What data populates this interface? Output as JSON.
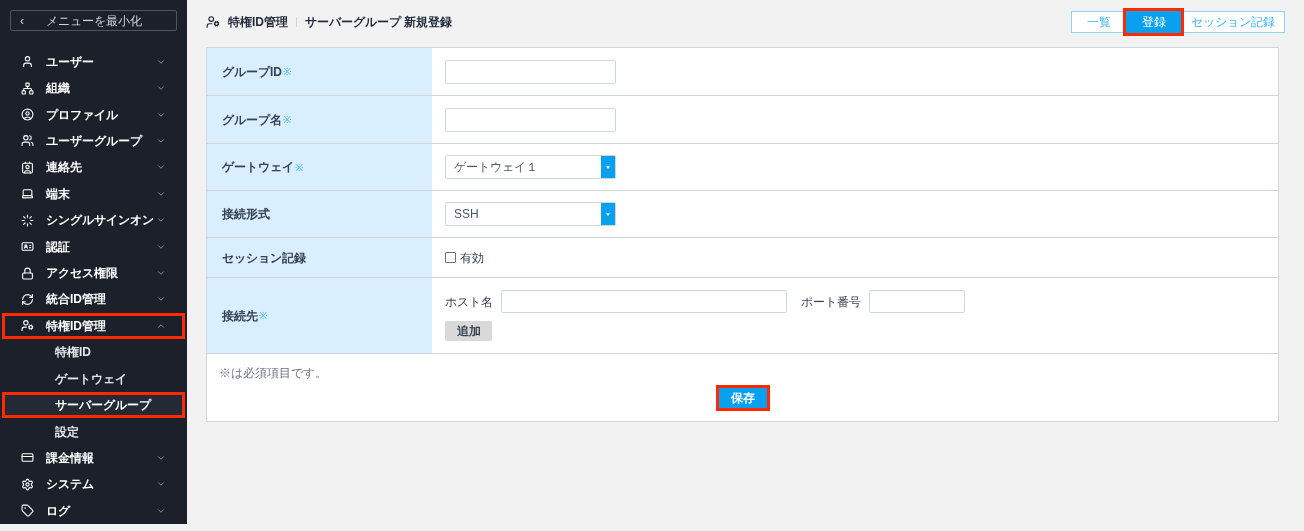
{
  "sidebar": {
    "collapse_button": {
      "icon": "‹",
      "label": "メニューを最小化"
    },
    "items": [
      {
        "label": "ユーザー",
        "expanded": false,
        "highlighted": false
      },
      {
        "label": "組織",
        "expanded": false,
        "highlighted": false
      },
      {
        "label": "プロファイル",
        "expanded": false,
        "highlighted": false
      },
      {
        "label": "ユーザーグループ",
        "expanded": false,
        "highlighted": false
      },
      {
        "label": "連絡先",
        "expanded": false,
        "highlighted": false
      },
      {
        "label": "端末",
        "expanded": false,
        "highlighted": false
      },
      {
        "label": "シングルサインオン",
        "expanded": false,
        "highlighted": false
      },
      {
        "label": "認証",
        "expanded": false,
        "highlighted": false
      },
      {
        "label": "アクセス権限",
        "expanded": false,
        "highlighted": false
      },
      {
        "label": "統合ID管理",
        "expanded": false,
        "highlighted": false
      },
      {
        "label": "特権ID管理",
        "expanded": true,
        "highlighted": true,
        "children": [
          {
            "label": "特権ID",
            "selected": false,
            "highlighted": false
          },
          {
            "label": "ゲートウェイ",
            "selected": false,
            "highlighted": false
          },
          {
            "label": "サーバーグループ",
            "selected": true,
            "highlighted": true
          },
          {
            "label": "設定",
            "selected": false,
            "highlighted": false
          }
        ]
      },
      {
        "label": "課金情報",
        "expanded": false,
        "highlighted": false
      },
      {
        "label": "システム",
        "expanded": false,
        "highlighted": false
      },
      {
        "label": "ログ",
        "expanded": false,
        "highlighted": false
      }
    ]
  },
  "header": {
    "section": "特権ID管理",
    "title": "サーバーグループ 新規登録"
  },
  "top_buttons": [
    {
      "label": "一覧",
      "selected": false,
      "highlighted": false
    },
    {
      "label": "登録",
      "selected": true,
      "highlighted": true
    },
    {
      "label": "セッション記録",
      "selected": false,
      "highlighted": false
    }
  ],
  "form": {
    "rows": [
      {
        "label": "グループID",
        "required": true,
        "kind": "text"
      },
      {
        "label": "グループ名",
        "required": true,
        "kind": "text"
      },
      {
        "label": "ゲートウェイ",
        "required": true,
        "kind": "select",
        "value": "ゲートウェイ１"
      },
      {
        "label": "接続形式",
        "required": false,
        "kind": "select",
        "value": "SSH"
      },
      {
        "label": "セッション記録",
        "required": false,
        "kind": "checkbox",
        "checked": false,
        "option": "有効"
      },
      {
        "label": "接続先",
        "required": true,
        "kind": "destination",
        "host_label": "ホスト名",
        "port_label": "ポート番号",
        "add_button": "追加"
      }
    ],
    "required_mark": "※",
    "footnote": "※は必須項目です。",
    "save_button": {
      "label": "保存",
      "highlighted": true
    }
  }
}
